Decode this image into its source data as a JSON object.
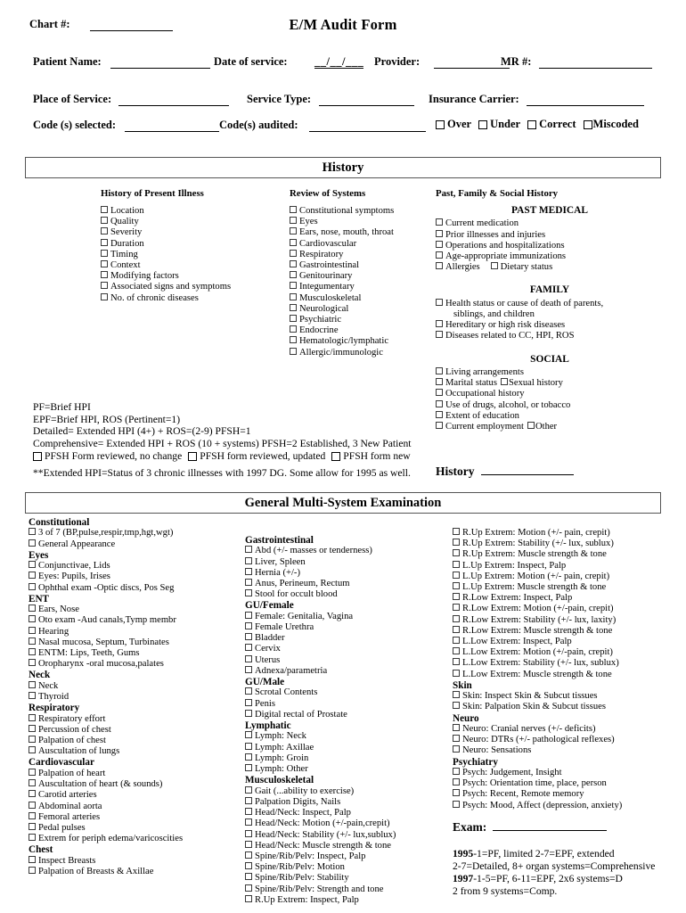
{
  "header": {
    "chart_label": "Chart #:",
    "title": "E/M Audit Form",
    "patient_name_label": "Patient Name:",
    "date_of_service_label": "Date of service:",
    "date_slashes": "__/__/___",
    "provider_label": "Provider:",
    "mr_label": "MR #:",
    "place_of_service_label": "Place of Service:",
    "service_type_label": "Service Type:",
    "insurance_carrier_label": "Insurance Carrier:",
    "codes_selected_label": "Code (s) selected:",
    "codes_audited_label": "Code(s) audited:",
    "audit_results": [
      "Over",
      "Under",
      "Correct",
      "Miscoded"
    ]
  },
  "history": {
    "section_title": "History",
    "hpi": {
      "heading": "History of Present Illness",
      "items": [
        "Location",
        "Quality",
        "Severity",
        "Duration",
        "Timing",
        "Context",
        "Modifying factors",
        "Associated signs and symptoms",
        "No. of chronic diseases"
      ]
    },
    "ros": {
      "heading": "Review of Systems",
      "items": [
        "Constitutional symptoms",
        "Eyes",
        "Ears, nose, mouth, throat",
        "Cardiovascular",
        "Respiratory",
        "Gastrointestinal",
        "Genitourinary",
        "Integumentary",
        "Musculoskeletal",
        "Neurological",
        "Psychiatric",
        "Endocrine",
        "Hematologic/lymphatic",
        "Allergic/immunologic"
      ]
    },
    "pfsh": {
      "heading": "Past, Family & Social History",
      "past_medical_heading": "PAST MEDICAL",
      "past_medical_items": [
        "Current medication",
        "Prior illnesses and injuries",
        "Operations and hospitalizations",
        "Age-appropriate immunizations"
      ],
      "allergies": "Allergies",
      "dietary_status": "Dietary status",
      "family_heading": "FAMILY",
      "family_items": [
        "Health status or cause of death of parents,",
        "Hereditary or high risk diseases",
        "Diseases related to CC, HPI, ROS"
      ],
      "family_item_cont": "siblings, and children",
      "social_heading": "SOCIAL",
      "social_items": [
        "Living arrangements",
        "Occupational history",
        "Use of drugs, alcohol, or tobacco",
        "Extent of education"
      ],
      "marital_status": "Marital status",
      "sexual_history": "Sexual history",
      "current_employment": "Current employment",
      "other": "Other"
    },
    "levels": [
      "PF=Brief HPI",
      "EPF=Brief HPI, ROS (Pertinent=1)",
      "Detailed= Extended HPI (4+) + ROS=(2-9) PFSH=1",
      "Comprehensive= Extended HPI + ROS (10 + systems) PFSH=2 Established, 3 New Patient"
    ],
    "pfsh_checkboxes": [
      "PFSH Form reviewed, no change",
      "PFSH form reviewed, updated",
      "PFSH form new"
    ],
    "footnote": "**Extended HPI=Status of 3 chronic illnesses with 1997 DG. Some allow for 1995 as well.",
    "history_score_label": "History"
  },
  "exam": {
    "section_title": "General Multi-System Examination",
    "col1": [
      {
        "group": "Constitutional",
        "items": [
          "3 of 7 (BP,pulse,respir,tmp,hgt,wgt)",
          "General Appearance"
        ]
      },
      {
        "group": "Eyes",
        "items": [
          "Conjunctivae, Lids",
          "Eyes: Pupils, Irises",
          "Ophthal exam -Optic discs, Pos Seg"
        ]
      },
      {
        "group": "ENT",
        "items": [
          "Ears, Nose",
          "Oto exam -Aud canals,Tymp membr",
          "Hearing",
          "Nasal mucosa, Septum, Turbinates",
          "ENTM: Lips, Teeth, Gums",
          "Oropharynx -oral mucosa,palates"
        ]
      },
      {
        "group": "Neck",
        "items": [
          "Neck",
          "Thyroid"
        ]
      },
      {
        "group": "Respiratory",
        "items": [
          "Respiratory effort",
          "Percussion of chest",
          "Palpation of chest",
          "Auscultation of lungs"
        ]
      },
      {
        "group": "Cardiovascular",
        "items": [
          "Palpation of heart",
          "Auscultation of heart (& sounds)",
          "Carotid arteries",
          "Abdominal aorta",
          "Femoral arteries",
          "Pedal pulses",
          "Extrem for periph edema/varicoscities"
        ]
      },
      {
        "group": "Chest",
        "items": [
          "Inspect Breasts",
          "Palpation of Breasts & Axillae"
        ]
      }
    ],
    "col2": [
      {
        "group": "Gastrointestinal",
        "items": [
          "Abd  (+/- masses or tenderness)",
          "Liver, Spleen",
          "Hernia (+/-)",
          "Anus, Perineum, Rectum",
          "Stool for occult blood"
        ]
      },
      {
        "group": "GU/Female",
        "items": [
          "Female: Genitalia, Vagina",
          "Female Urethra",
          "Bladder",
          "Cervix",
          "Uterus",
          "Adnexa/parametria"
        ]
      },
      {
        "group": "GU/Male",
        "items": [
          "Scrotal Contents",
          "Penis",
          "Digital rectal of Prostate"
        ]
      },
      {
        "group": "Lymphatic",
        "items": [
          "Lymph: Neck",
          "Lymph: Axillae",
          "Lymph: Groin",
          "Lymph: Other"
        ]
      },
      {
        "group": "Musculoskeletal",
        "items": [
          "Gait (...ability to exercise)",
          "Palpation Digits, Nails",
          "Head/Neck: Inspect, Palp",
          "Head/Neck: Motion  (+/-pain,crepit)",
          "Head/Neck: Stability (+/- lux,sublux)",
          "Head/Neck: Muscle strength & tone",
          "Spine/Rib/Pelv: Inspect, Palp",
          "Spine/Rib/Pelv: Motion",
          "Spine/Rib/Pelv: Stability",
          "Spine/Rib/Pelv: Strength and tone",
          "R.Up Extrem: Inspect, Palp"
        ]
      }
    ],
    "col3": [
      {
        "group": "",
        "items": [
          "R.Up Extrem: Motion  (+/- pain, crepit)",
          "R.Up Extrem: Stability  (+/- lux, sublux)",
          "R.Up Extrem: Muscle strength & tone",
          "L.Up Extrem: Inspect, Palp",
          "L.Up Extrem: Motion  (+/- pain, crepit)",
          "L.Up Extrem: Muscle strength & tone",
          "R.Low Extrem: Inspect, Palp",
          "R.Low Extrem: Motion (+/-pain, crepit)",
          "R.Low Extrem: Stability  (+/- lux, laxity)",
          "R.Low Extrem: Muscle strength & tone",
          "L.Low Extrem: Inspect, Palp",
          "L.Low Extrem: Motion  (+/-pain, crepit)",
          "L.Low Extrem: Stability (+/- lux, sublux)",
          "L.Low Extrem: Muscle strength & tone"
        ]
      },
      {
        "group": "Skin",
        "items": [
          "Skin: Inspect Skin & Subcut tissues",
          "Skin: Palpation Skin & Subcut tissues"
        ]
      },
      {
        "group": "Neuro",
        "items": [
          "Neuro: Cranial nerves  (+/- deficits)",
          "Neuro: DTRs  (+/- pathological reflexes)",
          "Neuro: Sensations"
        ]
      },
      {
        "group": "Psychiatry",
        "items": [
          "Psych: Judgement, Insight",
          "Psych: Orientation time, place, person",
          "Psych: Recent, Remote memory",
          "Psych: Mood, Affect (depression, anxiety)"
        ]
      }
    ],
    "exam_score_label": "Exam:",
    "guidelines": [
      {
        "bold": "1995",
        "rest": "-1=PF, limited 2-7=EPF, extended"
      },
      {
        "bold": "",
        "rest": "2-7=Detailed, 8+ organ systems=Comprehensive"
      },
      {
        "bold": "1997",
        "rest": "-1-5=PF, 6-11=EPF, 2x6 systems=D"
      },
      {
        "bold": "",
        "rest": "2 from 9 systems=Comp."
      }
    ]
  }
}
